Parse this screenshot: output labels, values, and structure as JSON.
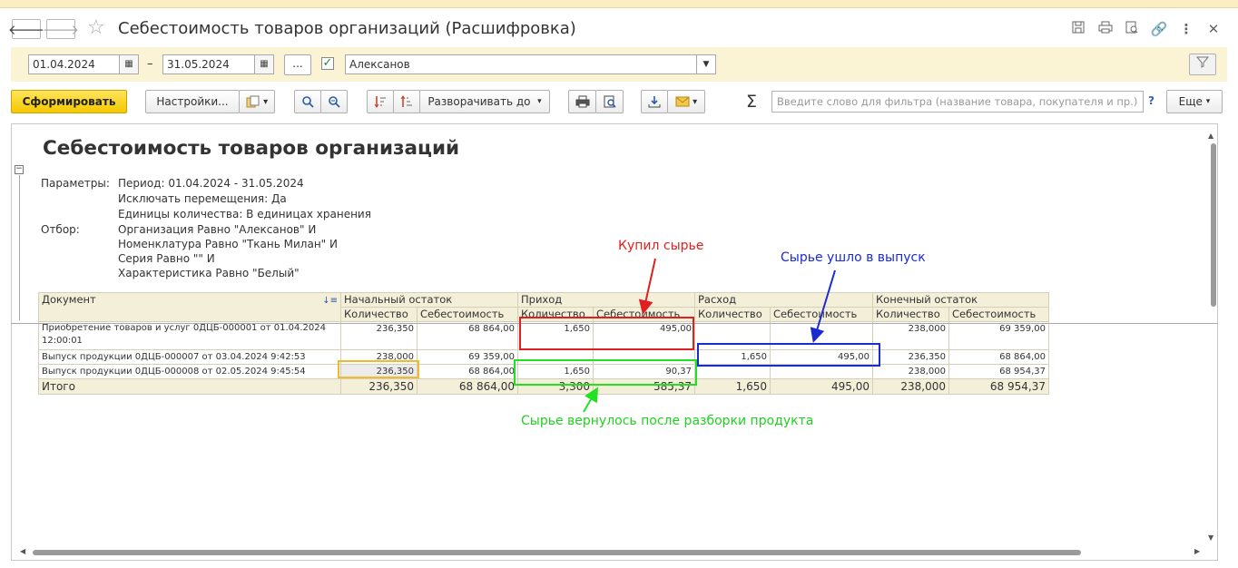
{
  "window": {
    "title": "Себестоимость товаров организаций (Расшифровка)"
  },
  "params": {
    "date_from": "01.04.2024",
    "date_to": "31.05.2024",
    "dash": "–",
    "ellipsis": "...",
    "organization": "Алексанов"
  },
  "toolbar": {
    "generate": "Сформировать",
    "settings": "Настройки...",
    "expand_to": "Разворачивать до",
    "search_placeholder": "Введите слово для фильтра (название товара, покупателя и пр.)",
    "help": "?",
    "more": "Еще"
  },
  "report": {
    "title": "Себестоимость товаров организаций",
    "params_label": "Параметры:",
    "params": [
      "Период: 01.04.2024 - 31.05.2024",
      "Исключать перемещения: Да",
      "Единицы количества: В единицах хранения"
    ],
    "filter_label": "Отбор:",
    "filters": [
      "Организация Равно \"Алексанов\" И",
      "Номенклатура Равно \"Ткань Милан\" И",
      "Серия Равно \"\" И",
      "Характеристика Равно \"Белый\""
    ],
    "table": {
      "col_document": "Документ",
      "groups": [
        "Начальный остаток",
        "Приход",
        "Расход",
        "Конечный остаток"
      ],
      "sub_qty": "Количество",
      "sub_cost": "Себестоимость",
      "rows": [
        {
          "doc": "Приобретение товаров и услуг 0ДЦБ-000001 от 01.04.2024",
          "doc2": "12:00:01",
          "c": [
            "236,350",
            "68 864,00",
            "1,650",
            "495,00",
            "",
            "",
            "238,000",
            "69 359,00"
          ]
        },
        {
          "doc": "Выпуск продукции 0ДЦБ-000007 от 03.04.2024 9:42:53",
          "doc2": "",
          "c": [
            "238,000",
            "69 359,00",
            "",
            "",
            "1,650",
            "495,00",
            "236,350",
            "68 864,00"
          ]
        },
        {
          "doc": "Выпуск продукции 0ДЦБ-000008 от 02.05.2024 9:45:54",
          "doc2": "",
          "c": [
            "236,350",
            "68 864,00",
            "1,650",
            "90,37",
            "",
            "",
            "238,000",
            "68 954,37"
          ]
        }
      ],
      "total": {
        "label": "Итого",
        "c": [
          "236,350",
          "68 864,00",
          "3,300",
          "585,37",
          "1,650",
          "495,00",
          "238,000",
          "68 954,37"
        ]
      }
    }
  },
  "annotations": {
    "red": "Купил сырье",
    "blue": "Сырье ушло в выпуск",
    "green": "Сырье вернулось после разборки продукта"
  },
  "icons": [
    "back-arrow-icon",
    "forward-arrow-icon",
    "star-icon",
    "save-icon",
    "print-icon",
    "preview-icon",
    "link-icon",
    "more-vert-icon",
    "close-icon",
    "calendar-icon",
    "checkbox-icon",
    "filter-icon",
    "search-icon",
    "sort-icon",
    "sigma-icon",
    "email-icon"
  ]
}
